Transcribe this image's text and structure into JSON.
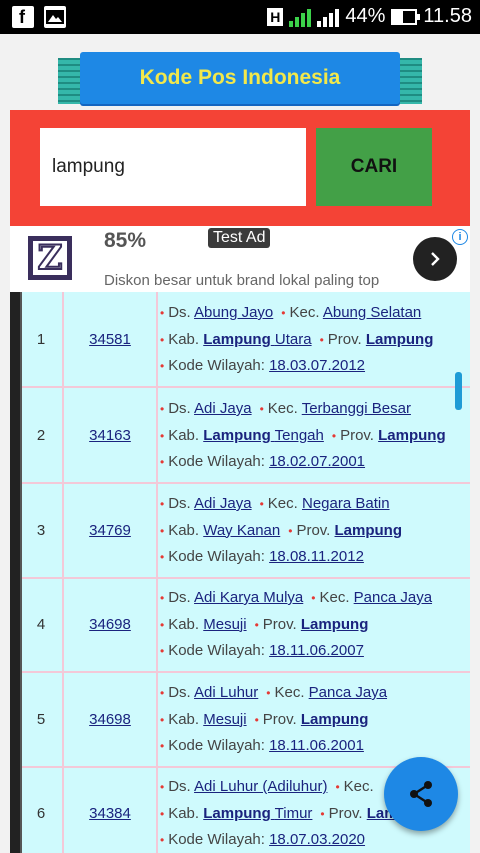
{
  "status": {
    "battery": "44%",
    "time": "11.58",
    "network_badge": "H",
    "sim1": "1",
    "sim2": "2"
  },
  "app": {
    "title": "Kode Pos Indonesia"
  },
  "search": {
    "value": "lampung",
    "button": "CARI"
  },
  "ad": {
    "percent": "85%",
    "tag": "Test Ad",
    "description": "Diskon besar untuk brand lokal paling top",
    "logo_letter": "Z"
  },
  "labels": {
    "ds": "Ds.",
    "kec": "Kec.",
    "kab": "Kab.",
    "prov": "Prov.",
    "kode_wilayah": "Kode Wilayah:"
  },
  "rows": [
    {
      "no": "1",
      "kode": "34581",
      "desa": "Abung Jayo",
      "kec": "Abung Selatan",
      "kab_bold": "Lampung",
      "kab_rest": "Utara",
      "prov": "Lampung",
      "wilayah": "18.03.07.2012"
    },
    {
      "no": "2",
      "kode": "34163",
      "desa": "Adi Jaya",
      "kec": "Terbanggi Besar",
      "kab_bold": "Lampung",
      "kab_rest": "Tengah",
      "prov": "Lampung",
      "wilayah": "18.02.07.2001"
    },
    {
      "no": "3",
      "kode": "34769",
      "desa": "Adi Jaya",
      "kec": "Negara Batin",
      "kab_bold": "",
      "kab_rest": "Way Kanan",
      "prov": "Lampung",
      "wilayah": "18.08.11.2012"
    },
    {
      "no": "4",
      "kode": "34698",
      "desa": "Adi Karya Mulya",
      "kec": "Panca Jaya",
      "kab_bold": "",
      "kab_rest": "Mesuji",
      "prov": "Lampung",
      "wilayah": "18.11.06.2007"
    },
    {
      "no": "5",
      "kode": "34698",
      "desa": "Adi Luhur",
      "kec": "Panca Jaya",
      "kab_bold": "",
      "kab_rest": "Mesuji",
      "prov": "Lampung",
      "wilayah": "18.11.06.2001"
    },
    {
      "no": "6",
      "kode": "34384",
      "desa": "Adi Luhur (Adiluhur)",
      "kec": "",
      "kab_bold": "Lampung",
      "kab_rest": "Timur",
      "prov": "Lampung",
      "wilayah": "18.07.03.2020"
    }
  ],
  "icons": {
    "share": "share-icon",
    "chevron": "chevron-right-icon",
    "info": "info-icon"
  },
  "colors": {
    "search_bg": "#f44336",
    "search_button": "#43a047",
    "title_bg": "#1e88e5",
    "title_text": "#f2e84b",
    "row_bg": "#cffafd",
    "fab": "#1e88e5"
  }
}
